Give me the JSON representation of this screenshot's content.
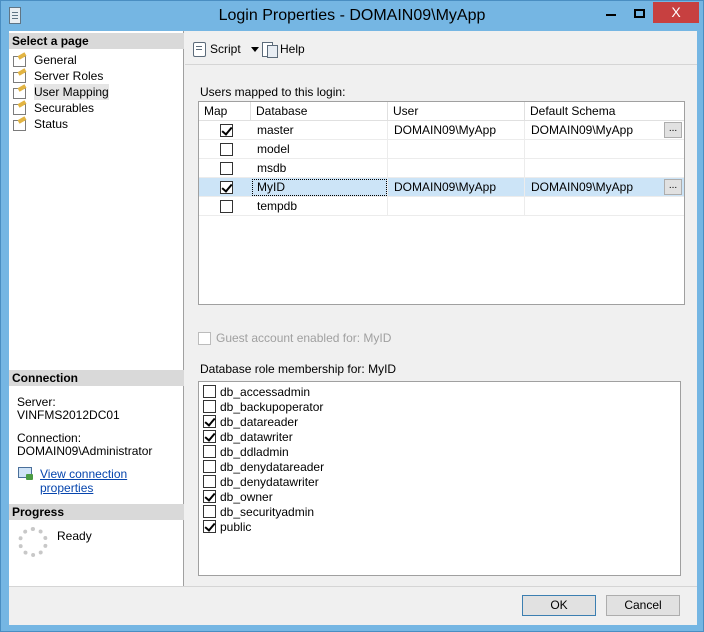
{
  "window": {
    "title": "Login Properties - DOMAIN09\\MyApp",
    "minimize_glyph": "–",
    "maximize_glyph": "□",
    "close_glyph": "X"
  },
  "left": {
    "select_page_header": "Select a page",
    "pages": [
      {
        "label": "General",
        "icon": "wrench-page-icon",
        "selected": false
      },
      {
        "label": "Server Roles",
        "icon": "wrench-page-icon",
        "selected": false
      },
      {
        "label": "User Mapping",
        "icon": "wrench-page-icon",
        "selected": true
      },
      {
        "label": "Securables",
        "icon": "wrench-page-icon",
        "selected": false
      },
      {
        "label": "Status",
        "icon": "wrench-page-icon",
        "selected": false
      }
    ],
    "connection_header": "Connection",
    "server_label": "Server:",
    "server_value": "VINFMS2012DC01",
    "connection_label": "Connection:",
    "connection_value": "DOMAIN09\\Administrator",
    "view_link": "View connection properties",
    "progress_header": "Progress",
    "progress_status": "Ready"
  },
  "toolbar": {
    "script_label": "Script",
    "help_label": "Help"
  },
  "mapping": {
    "label": "Users mapped to this login:",
    "columns": [
      "Map",
      "Database",
      "User",
      "Default Schema"
    ],
    "rows": [
      {
        "map": true,
        "database": "master",
        "user": "DOMAIN09\\MyApp",
        "schema": "DOMAIN09\\MyApp",
        "selected": false
      },
      {
        "map": false,
        "database": "model",
        "user": "",
        "schema": "",
        "selected": false
      },
      {
        "map": false,
        "database": "msdb",
        "user": "",
        "schema": "",
        "selected": false
      },
      {
        "map": true,
        "database": "MyID",
        "user": "DOMAIN09\\MyApp",
        "schema": "DOMAIN09\\MyApp",
        "selected": true
      },
      {
        "map": false,
        "database": "tempdb",
        "user": "",
        "schema": "",
        "selected": false
      }
    ],
    "ellipsis": "..."
  },
  "guest": {
    "label": "Guest account enabled for: MyID",
    "checked": false
  },
  "roles": {
    "label": "Database role membership for: MyID",
    "items": [
      {
        "name": "db_accessadmin",
        "checked": false
      },
      {
        "name": "db_backupoperator",
        "checked": false
      },
      {
        "name": "db_datareader",
        "checked": true
      },
      {
        "name": "db_datawriter",
        "checked": true
      },
      {
        "name": "db_ddladmin",
        "checked": false
      },
      {
        "name": "db_denydatareader",
        "checked": false
      },
      {
        "name": "db_denydatawriter",
        "checked": false
      },
      {
        "name": "db_owner",
        "checked": true
      },
      {
        "name": "db_securityadmin",
        "checked": false
      },
      {
        "name": "public",
        "checked": true
      }
    ]
  },
  "footer": {
    "ok_label": "OK",
    "cancel_label": "Cancel"
  }
}
